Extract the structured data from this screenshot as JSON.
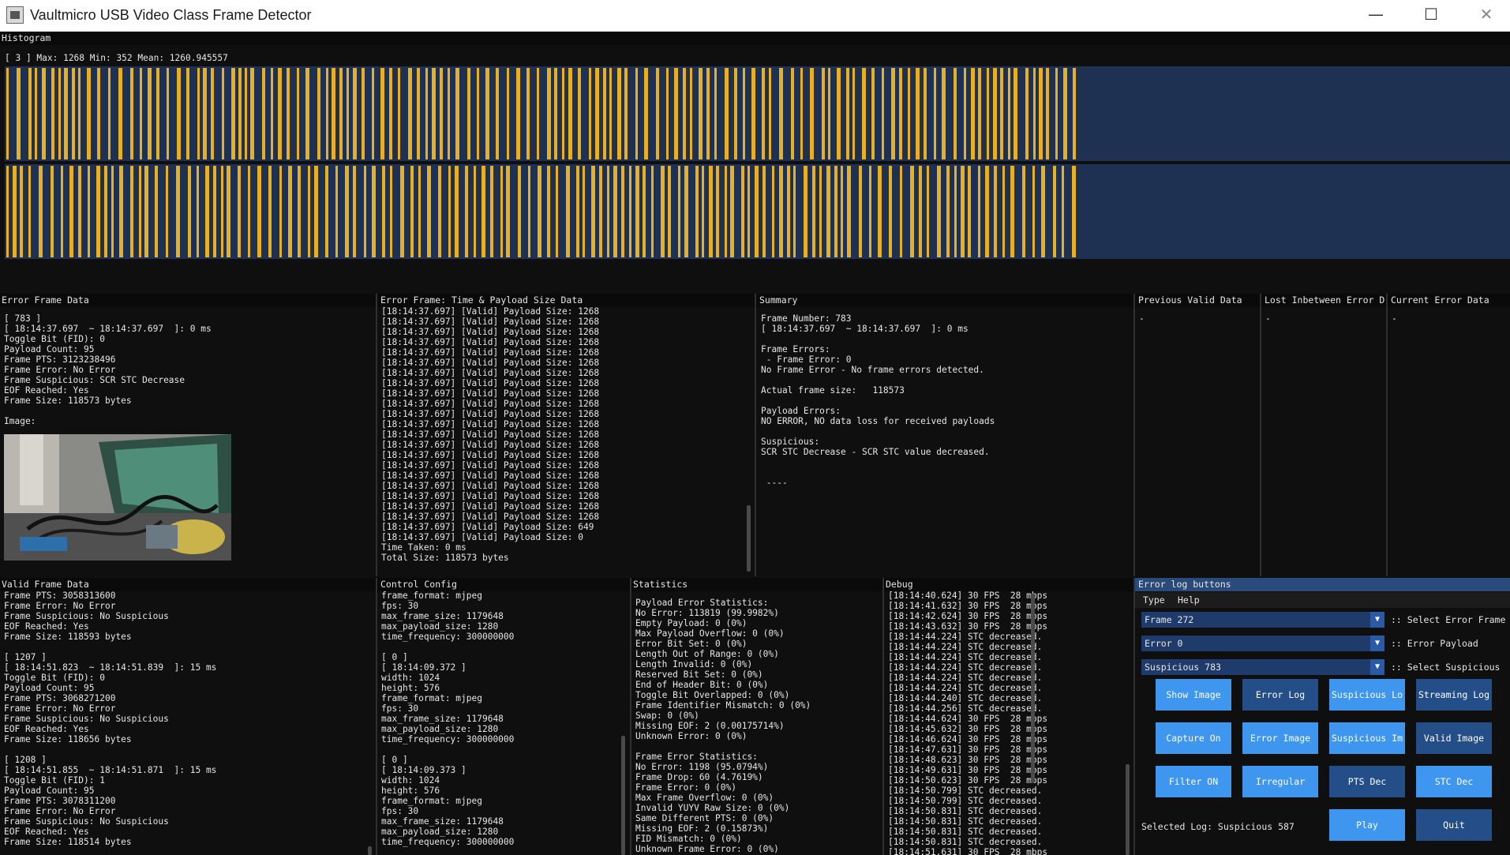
{
  "window": {
    "title": "Vaultmicro USB Video Class Frame Detector",
    "minimize": "—",
    "maximize": "☐",
    "close": "✕"
  },
  "histogram": {
    "title": "Histogram",
    "info": "[ 3 ] Max: 1268 Min: 352 Mean: 1260.945557",
    "bar_color": "#e8b020",
    "background_color": "#1f3152"
  },
  "error_frame_data": {
    "title": "Error Frame Data",
    "text": "[ 783 ]\n[ 18:14:37.697  ~ 18:14:37.697  ]: 0 ms\nToggle Bit (FID): 0\nPayload Count: 95\nFrame PTS: 3123238496\nFrame Error: No Error\nFrame Suspicious: SCR STC Decrease\nEOF Reached: Yes\nFrame Size: 118573 bytes\n\nImage:"
  },
  "time_payload": {
    "title": "Error Frame: Time & Payload Size Data",
    "text": "[18:14:37.697] [Valid] Payload Size: 1268\n[18:14:37.697] [Valid] Payload Size: 1268\n[18:14:37.697] [Valid] Payload Size: 1268\n[18:14:37.697] [Valid] Payload Size: 1268\n[18:14:37.697] [Valid] Payload Size: 1268\n[18:14:37.697] [Valid] Payload Size: 1268\n[18:14:37.697] [Valid] Payload Size: 1268\n[18:14:37.697] [Valid] Payload Size: 1268\n[18:14:37.697] [Valid] Payload Size: 1268\n[18:14:37.697] [Valid] Payload Size: 1268\n[18:14:37.697] [Valid] Payload Size: 1268\n[18:14:37.697] [Valid] Payload Size: 1268\n[18:14:37.697] [Valid] Payload Size: 1268\n[18:14:37.697] [Valid] Payload Size: 1268\n[18:14:37.697] [Valid] Payload Size: 1268\n[18:14:37.697] [Valid] Payload Size: 1268\n[18:14:37.697] [Valid] Payload Size: 1268\n[18:14:37.697] [Valid] Payload Size: 1268\n[18:14:37.697] [Valid] Payload Size: 1268\n[18:14:37.697] [Valid] Payload Size: 1268\n[18:14:37.697] [Valid] Payload Size: 1268\n[18:14:37.697] [Valid] Payload Size: 649\n[18:14:37.697] [Valid] Payload Size: 0\nTime Taken: 0 ms\nTotal Size: 118573 bytes"
  },
  "summary": {
    "title": "Summary",
    "text": "Frame Number: 783\n[ 18:14:37.697  ~ 18:14:37.697  ]: 0 ms\n\nFrame Errors:\n - Frame Error: 0\nNo Frame Error - No frame errors detected.\n\nActual frame size:   118573\n\nPayload Errors:\nNO ERROR, NO data loss for received payloads\n\nSuspicious:\nSCR STC Decrease - SCR STC value decreased.\n\n\n ----"
  },
  "previous_valid": {
    "title": "Previous Valid Data",
    "text": "-"
  },
  "lost_between": {
    "title": "Lost Inbetween Error D",
    "text": "-"
  },
  "current_error": {
    "title": "Current Error Data",
    "text": "-"
  },
  "valid_frame_data": {
    "title": "Valid Frame Data",
    "text": "Frame PTS: 3058313600\nFrame Error: No Error\nFrame Suspicious: No Suspicious\nEOF Reached: Yes\nFrame Size: 118593 bytes\n\n[ 1207 ]\n[ 18:14:51.823  ~ 18:14:51.839  ]: 15 ms\nToggle Bit (FID): 0\nPayload Count: 95\nFrame PTS: 3068271200\nFrame Error: No Error\nFrame Suspicious: No Suspicious\nEOF Reached: Yes\nFrame Size: 118656 bytes\n\n[ 1208 ]\n[ 18:14:51.855  ~ 18:14:51.871  ]: 15 ms\nToggle Bit (FID): 1\nPayload Count: 95\nFrame PTS: 3078311200\nFrame Error: No Error\nFrame Suspicious: No Suspicious\nEOF Reached: Yes\nFrame Size: 118514 bytes"
  },
  "control_config": {
    "title": "Control Config",
    "text": "frame_format: mjpeg\nfps: 30\nmax_frame_size: 1179648\nmax_payload_size: 1280\ntime_frequency: 300000000\n\n[ 0 ]\n[ 18:14:09.372 ]\nwidth: 1024\nheight: 576\nframe_format: mjpeg\nfps: 30\nmax_frame_size: 1179648\nmax_payload_size: 1280\ntime_frequency: 300000000\n\n[ 0 ]\n[ 18:14:09.373 ]\nwidth: 1024\nheight: 576\nframe_format: mjpeg\nfps: 30\nmax_frame_size: 1179648\nmax_payload_size: 1280\ntime_frequency: 300000000"
  },
  "statistics": {
    "title": "Statistics",
    "text": "Payload Error Statistics:\nNo Error: 113819 (99.9982%)\nEmpty Payload: 0 (0%)\nMax Payload Overflow: 0 (0%)\nError Bit Set: 0 (0%)\nLength Out of Range: 0 (0%)\nLength Invalid: 0 (0%)\nReserved Bit Set: 0 (0%)\nEnd of Header Bit: 0 (0%)\nToggle Bit Overlapped: 0 (0%)\nFrame Identifier Mismatch: 0 (0%)\nSwap: 0 (0%)\nMissing EOF: 2 (0.00175714%)\nUnknown Error: 0 (0%)\n\nFrame Error Statistics:\nNo Error: 1198 (95.0794%)\nFrame Drop: 60 (4.7619%)\nFrame Error: 0 (0%)\nMax Frame Overflow: 0 (0%)\nInvalid YUYV Raw Size: 0 (0%)\nSame Different PTS: 0 (0%)\nMissing EOF: 2 (0.15873%)\nFID Mismatch: 0 (0%)\nUnknown Frame Error: 0 (0%)"
  },
  "debug": {
    "title": "Debug",
    "text": "[18:14:40.624] 30 FPS  28 mbps\n[18:14:41.632] 30 FPS  28 mbps\n[18:14:42.624] 30 FPS  28 mbps\n[18:14:43.632] 30 FPS  28 mbps\n[18:14:44.224] STC decreased.\n[18:14:44.224] STC decreased.\n[18:14:44.224] STC decreased.\n[18:14:44.224] STC decreased.\n[18:14:44.224] STC decreased.\n[18:14:44.224] STC decreased.\n[18:14:44.240] STC decreased.\n[18:14:44.256] STC decreased.\n[18:14:44.624] 30 FPS  28 mbps\n[18:14:45.632] 30 FPS  28 mbps\n[18:14:46.624] 30 FPS  28 mbps\n[18:14:47.631] 30 FPS  28 mbps\n[18:14:48.623] 30 FPS  28 mbps\n[18:14:49.631] 30 FPS  28 mbps\n[18:14:50.623] 30 FPS  28 mbps\n[18:14:50.799] STC decreased.\n[18:14:50.799] STC decreased.\n[18:14:50.831] STC decreased.\n[18:14:50.831] STC decreased.\n[18:14:50.831] STC decreased.\n[18:14:50.831] STC decreased.\n[18:14:51.631] 30 FPS  28 mbps"
  },
  "error_log": {
    "title": "Error log buttons",
    "menu": [
      "Type",
      "Help"
    ],
    "combo_frame": "Frame 272",
    "combo_frame_label": ":: Select Error Frame",
    "combo_error": "Error 0",
    "combo_error_label": ":: Error Payload",
    "combo_suspicious": "Suspicious 783",
    "combo_suspicious_label": ":: Select Suspicious",
    "buttons": {
      "show_image": "Show Image",
      "error_log": "Error Log",
      "suspicious_log": "Suspicious Lo",
      "streaming_log": "Streaming Log",
      "capture_on": "Capture On",
      "error_image": "Error Image",
      "suspicious_image": "Suspicious Im",
      "valid_image": "Valid Image",
      "filter_on": "Filter ON",
      "irregular": "Irregular",
      "pts_dec": "PTS Dec",
      "stc_dec": "STC Dec",
      "play": "Play",
      "quit": "Quit"
    },
    "selected_log": "Selected Log: Suspicious 587"
  }
}
